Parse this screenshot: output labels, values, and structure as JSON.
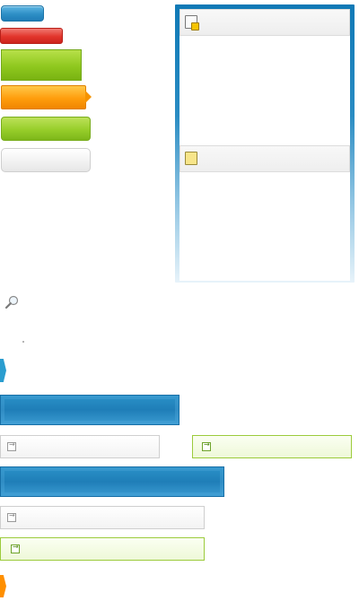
{
  "sprite_buttons": [
    {
      "name": "blue-small",
      "color": "#2e8fc6",
      "label": ""
    },
    {
      "name": "red",
      "color": "#e2352c",
      "label": ""
    },
    {
      "name": "green-square",
      "color": "#8fc81e",
      "label": ""
    },
    {
      "name": "orange-arrow",
      "color": "#ff9d0c",
      "label": ""
    },
    {
      "name": "green-rounded",
      "color": "#97ce2a",
      "label": ""
    },
    {
      "name": "gray-rounded",
      "color": "#f1f1f1",
      "label": ""
    }
  ],
  "panel": {
    "accent": "#0f79b6",
    "sections": [
      {
        "icon": "clipboard-warning-icon",
        "title": ""
      },
      {
        "icon": "note-icon",
        "title": ""
      }
    ]
  },
  "icons": [
    "magnifier-icon",
    "blue-tab-marker",
    "orange-tab-marker"
  ],
  "bars": [
    {
      "name": "blue-bar-1",
      "color": "#1f7eb8",
      "label": ""
    },
    {
      "name": "blue-bar-2",
      "color": "#1f7eb8",
      "label": ""
    }
  ],
  "fields": [
    {
      "name": "gray-field-1",
      "value": ""
    },
    {
      "name": "green-field-1",
      "value": ""
    },
    {
      "name": "gray-field-2",
      "value": ""
    },
    {
      "name": "green-field-2",
      "value": ""
    }
  ]
}
